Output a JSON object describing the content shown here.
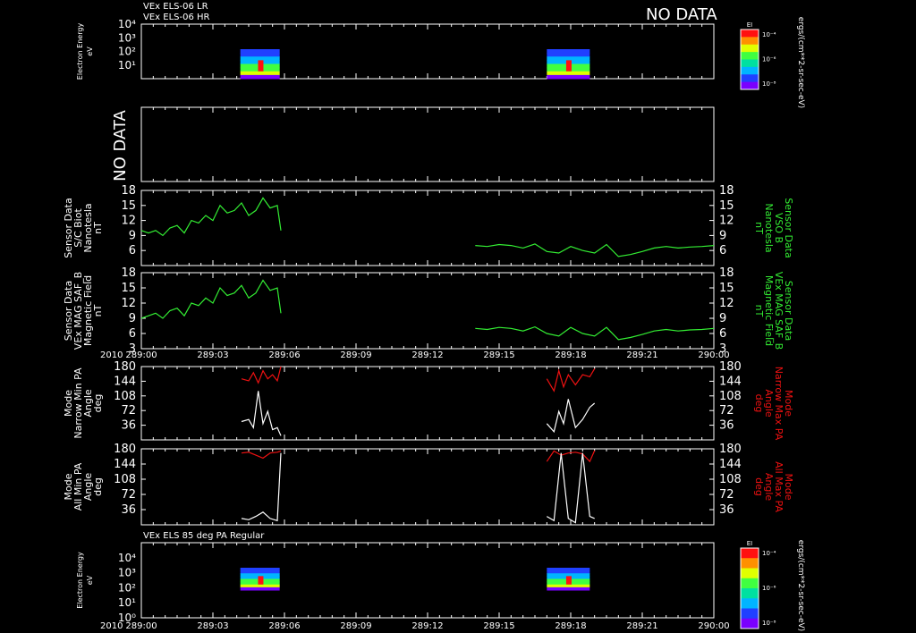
{
  "header": {
    "line1": "VEx ELS-06 LR",
    "line2": "VEx ELS-06 HR",
    "no_data": "NO DATA",
    "panel2_no_data": "NO DATA",
    "bottom_title": "VEx ELS 85 deg PA Regular"
  },
  "time_axis": {
    "year": "2010",
    "ticks": [
      "289:00",
      "289:03",
      "289:06",
      "289:09",
      "289:12",
      "289:15",
      "289:18",
      "289:21",
      "290:00"
    ]
  },
  "colorbar": {
    "label": "EI",
    "ticks": [
      "10⁻⁴",
      "10⁻⁶",
      "10⁻⁸"
    ],
    "units": "ergs/(cm**2-sr-sec-eV)"
  },
  "colors": {
    "background": "#000000",
    "axis": "#ffffff",
    "field": "#33ee33",
    "max_pa": "#ee1111",
    "min_pa": "#ffffff"
  },
  "chart_data": [
    {
      "type": "heatmap",
      "ylabel": [
        "Electron Energy",
        "eV"
      ],
      "ylog": true,
      "ytick_labels": [
        "10¹",
        "10²",
        "10³",
        "10⁴"
      ],
      "blocks_hours": [
        [
          4.15,
          5.8
        ],
        [
          17.0,
          18.8
        ]
      ]
    },
    {
      "type": "line",
      "ylabel_left": [
        "Sensor Data",
        "S/C Biot",
        "Nanotesla",
        "nT"
      ],
      "ylabel_right": [
        "Sensor Data",
        "VSO B",
        "Nanotesla",
        "nT"
      ],
      "ylim": [
        3,
        18
      ],
      "yticks": [
        6,
        9,
        12,
        15,
        18
      ],
      "series": [
        {
          "x": [
            0.0,
            0.3,
            0.6,
            0.9,
            1.2,
            1.5,
            1.8,
            2.1,
            2.4,
            2.7,
            3.0,
            3.3,
            3.6,
            3.9,
            4.2,
            4.5,
            4.8,
            5.1,
            5.4,
            5.7,
            5.85
          ],
          "y": [
            10,
            9.5,
            10,
            9,
            10.5,
            11,
            9.5,
            12,
            11.5,
            13,
            12,
            15,
            13.5,
            14,
            15.5,
            13,
            14,
            16.5,
            14.5,
            15,
            10
          ]
        },
        {
          "x": [
            14.0,
            14.5,
            15.0,
            15.5,
            16.0,
            16.5,
            17.0,
            17.5,
            18.0,
            18.5,
            19.0,
            19.5,
            20.0,
            20.5,
            21.0,
            21.5,
            22.0,
            22.5,
            23.0,
            23.5,
            24.0
          ],
          "y": [
            7,
            6.8,
            7.2,
            7,
            6.5,
            7.3,
            5.8,
            5.5,
            6.8,
            6,
            5.5,
            7.2,
            4.8,
            5.2,
            5.8,
            6.5,
            6.8,
            6.5,
            6.7,
            6.8,
            7
          ]
        }
      ]
    },
    {
      "type": "line",
      "ylabel_left": [
        "Sensor Data",
        "VEx MAG SAF_B",
        "Magnetic Field",
        "nT"
      ],
      "ylabel_right": [
        "Sensor Data",
        "VEx MAG SAF_B",
        "Magnetic Field",
        "nT"
      ],
      "ylim": [
        3,
        18
      ],
      "yticks": [
        3,
        6,
        9,
        12,
        15,
        18
      ],
      "series": [
        {
          "x": [
            0.0,
            0.3,
            0.6,
            0.9,
            1.2,
            1.5,
            1.8,
            2.1,
            2.4,
            2.7,
            3.0,
            3.3,
            3.6,
            3.9,
            4.2,
            4.5,
            4.8,
            5.1,
            5.4,
            5.7,
            5.85
          ],
          "y": [
            9,
            9.5,
            10,
            9,
            10.5,
            11,
            9.5,
            12,
            11.5,
            13,
            12,
            15,
            13.5,
            14,
            15.5,
            13,
            14,
            16.5,
            14.5,
            15,
            10
          ]
        },
        {
          "x": [
            14.0,
            14.5,
            15.0,
            15.5,
            16.0,
            16.5,
            17.0,
            17.5,
            18.0,
            18.5,
            19.0,
            19.5,
            20.0,
            20.5,
            21.0,
            21.5,
            22.0,
            22.5,
            23.0,
            23.5,
            24.0
          ],
          "y": [
            7,
            6.8,
            7.2,
            7,
            6.5,
            7.3,
            6,
            5.5,
            7.2,
            6,
            5.5,
            7.2,
            4.8,
            5.2,
            5.8,
            6.5,
            6.8,
            6.5,
            6.7,
            6.8,
            7
          ]
        }
      ]
    },
    {
      "type": "line",
      "ylabel_left": [
        "Mode",
        "Narrow Min PA",
        "Angle",
        "deg"
      ],
      "ylabel_right": [
        "Mode",
        "Narrow Max PA",
        "Angle",
        "deg"
      ],
      "ylim": [
        0,
        180
      ],
      "yticks": [
        36,
        72,
        108,
        144,
        180
      ],
      "series": [
        {
          "x": [
            4.2,
            4.5,
            4.7,
            4.9,
            5.1,
            5.3,
            5.5,
            5.7,
            5.85
          ],
          "y": [
            150,
            145,
            165,
            140,
            170,
            150,
            160,
            145,
            180
          ]
        },
        {
          "x": [
            4.2,
            4.5,
            4.7,
            4.9,
            5.1,
            5.3,
            5.5,
            5.7,
            5.85
          ],
          "y": [
            45,
            50,
            30,
            120,
            40,
            70,
            25,
            30,
            10
          ]
        },
        {
          "x": [
            17.0,
            17.3,
            17.5,
            17.7,
            17.9,
            18.2,
            18.5,
            18.8,
            19.0
          ],
          "y": [
            150,
            120,
            170,
            130,
            160,
            135,
            160,
            155,
            175
          ]
        },
        {
          "x": [
            17.0,
            17.3,
            17.5,
            17.7,
            17.9,
            18.2,
            18.5,
            18.8,
            19.0
          ],
          "y": [
            40,
            20,
            70,
            40,
            100,
            30,
            50,
            80,
            90
          ]
        }
      ]
    },
    {
      "type": "line",
      "ylabel_left": [
        "Mode",
        "All Min PA",
        "Angle",
        "deg"
      ],
      "ylabel_right": [
        "Mode",
        "All Max PA",
        "Angle",
        "deg"
      ],
      "ylim": [
        0,
        180
      ],
      "yticks": [
        36,
        72,
        108,
        144,
        180
      ],
      "series": [
        {
          "x": [
            4.2,
            4.5,
            4.8,
            5.1,
            5.4,
            5.7,
            5.85
          ],
          "y": [
            170,
            172,
            165,
            158,
            170,
            172,
            175
          ]
        },
        {
          "x": [
            4.2,
            4.5,
            4.8,
            5.1,
            5.4,
            5.7,
            5.85
          ],
          "y": [
            15,
            12,
            20,
            30,
            15,
            10,
            170
          ]
        },
        {
          "x": [
            17.0,
            17.3,
            17.6,
            17.9,
            18.2,
            18.5,
            18.8,
            19.0
          ],
          "y": [
            150,
            175,
            165,
            170,
            172,
            168,
            150,
            176
          ]
        },
        {
          "x": [
            17.0,
            17.3,
            17.6,
            17.9,
            18.2,
            18.5,
            18.8,
            19.0
          ],
          "y": [
            20,
            10,
            170,
            15,
            5,
            170,
            20,
            15
          ]
        }
      ]
    },
    {
      "type": "heatmap",
      "ylabel": [
        "Electron Energy",
        "eV"
      ],
      "ylog": true,
      "ytick_labels": [
        "10⁰",
        "10¹",
        "10²",
        "10³",
        "10⁴"
      ],
      "bottom_label": "10¹",
      "blocks_hours": [
        [
          4.15,
          5.8
        ],
        [
          17.0,
          18.8
        ]
      ]
    }
  ]
}
